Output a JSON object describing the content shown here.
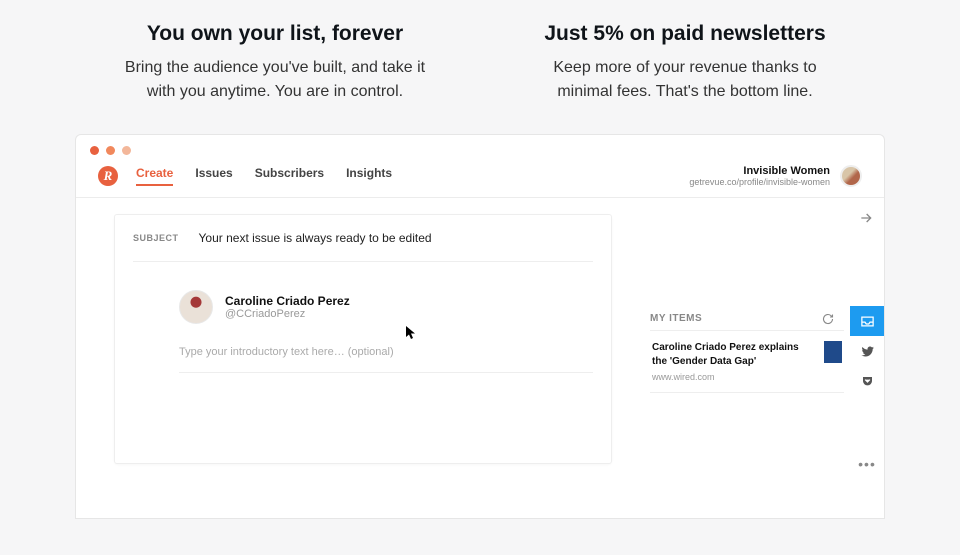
{
  "features": [
    {
      "title": "You own your list, forever",
      "body": "Bring the audience you've built, and take it with you anytime. You are in control."
    },
    {
      "title": "Just 5% on paid newsletters",
      "body": "Keep more of your revenue thanks to minimal fees. That's the bottom line."
    }
  ],
  "nav": {
    "items": [
      "Create",
      "Issues",
      "Subscribers",
      "Insights"
    ]
  },
  "profile": {
    "name": "Invisible Women",
    "url": "getrevue.co/profile/invisible-women"
  },
  "editor": {
    "subject_label": "SUBJECT",
    "subject_value": "Your next issue is always ready to be edited",
    "author_name": "Caroline Criado Perez",
    "author_handle": "@CCriadoPerez",
    "intro_placeholder": "Type your introductory text here… (optional)"
  },
  "items": {
    "title": "MY ITEMS",
    "entries": [
      {
        "title": "Caroline Criado Perez explains the 'Gender Data Gap'",
        "source": "www.wired.com"
      }
    ]
  },
  "rail": {
    "more": "•••"
  }
}
